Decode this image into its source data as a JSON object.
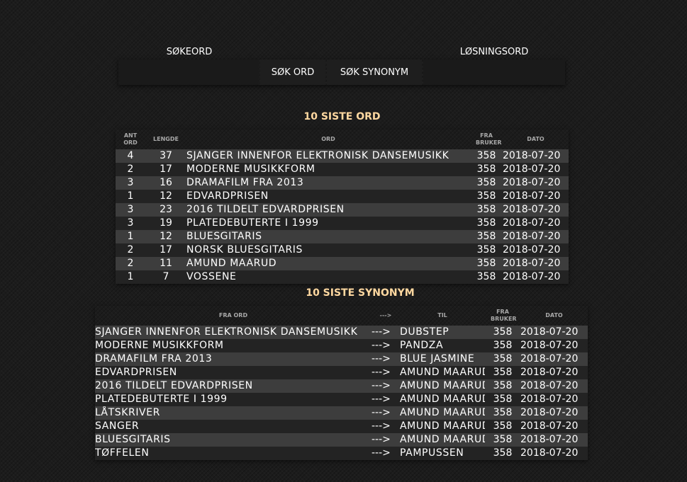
{
  "search": {
    "keyword_label": "SØKEORD",
    "solution_label": "LØSNINGSORD",
    "keyword_value": "",
    "solution_value": "",
    "search_word_button": "SØK ORD",
    "search_synonym_button": "SØK SYNONYM"
  },
  "words": {
    "title": "10 SISTE ORD",
    "headers": {
      "count": "ANT ORD",
      "length": "LENGDE",
      "word": "ORD",
      "user": "FRA BRUKER",
      "date": "DATO"
    },
    "rows": [
      {
        "count": "4",
        "length": "37",
        "word": "SJANGER INNENFOR ELEKTRONISK DANSEMUSIKK",
        "user": "358",
        "date": "2018-07-20"
      },
      {
        "count": "2",
        "length": "17",
        "word": "MODERNE MUSIKKFORM",
        "user": "358",
        "date": "2018-07-20"
      },
      {
        "count": "3",
        "length": "16",
        "word": "DRAMAFILM FRA 2013",
        "user": "358",
        "date": "2018-07-20"
      },
      {
        "count": "1",
        "length": "12",
        "word": "EDVARDPRISEN",
        "user": "358",
        "date": "2018-07-20"
      },
      {
        "count": "3",
        "length": "23",
        "word": "2016 TILDELT EDVARDPRISEN",
        "user": "358",
        "date": "2018-07-20"
      },
      {
        "count": "3",
        "length": "19",
        "word": "PLATEDEBUTERTE I 1999",
        "user": "358",
        "date": "2018-07-20"
      },
      {
        "count": "1",
        "length": "12",
        "word": "BLUESGITARIS",
        "user": "358",
        "date": "2018-07-20"
      },
      {
        "count": "2",
        "length": "17",
        "word": "NORSK BLUESGITARIS",
        "user": "358",
        "date": "2018-07-20"
      },
      {
        "count": "2",
        "length": "11",
        "word": "AMUND MAARUD",
        "user": "358",
        "date": "2018-07-20"
      },
      {
        "count": "1",
        "length": "7",
        "word": "VOSSENE",
        "user": "358",
        "date": "2018-07-20"
      }
    ]
  },
  "synonyms": {
    "title": "10 SISTE SYNONYM",
    "headers": {
      "from": "FRA ORD",
      "arrow": "--->",
      "to": "TIL",
      "user": "FRA BRUKER",
      "date": "DATO"
    },
    "rows": [
      {
        "from": "SJANGER INNENFOR ELEKTRONISK DANSEMUSIKK",
        "arrow": "--->",
        "to": "DUBSTEP",
        "user": "358",
        "date": "2018-07-20"
      },
      {
        "from": "MODERNE MUSIKKFORM",
        "arrow": "--->",
        "to": "PANDZA",
        "user": "358",
        "date": "2018-07-20"
      },
      {
        "from": "DRAMAFILM FRA 2013",
        "arrow": "--->",
        "to": "BLUE JASMINE",
        "user": "358",
        "date": "2018-07-20"
      },
      {
        "from": "EDVARDPRISEN",
        "arrow": "--->",
        "to": "AMUND MAARUD",
        "user": "358",
        "date": "2018-07-20"
      },
      {
        "from": "2016 TILDELT EDVARDPRISEN",
        "arrow": "--->",
        "to": "AMUND MAARUD",
        "user": "358",
        "date": "2018-07-20"
      },
      {
        "from": "PLATEDEBUTERTE I 1999",
        "arrow": "--->",
        "to": "AMUND MAARUD",
        "user": "358",
        "date": "2018-07-20"
      },
      {
        "from": "LÅTSKRIVER",
        "arrow": "--->",
        "to": "AMUND MAARUD",
        "user": "358",
        "date": "2018-07-20"
      },
      {
        "from": "SANGER",
        "arrow": "--->",
        "to": "AMUND MAARUD",
        "user": "358",
        "date": "2018-07-20"
      },
      {
        "from": "BLUESGITARIS",
        "arrow": "--->",
        "to": "AMUND MAARUD",
        "user": "358",
        "date": "2018-07-20"
      },
      {
        "from": "TØFFELEN",
        "arrow": "--->",
        "to": "PAMPUSSEN",
        "user": "358",
        "date": "2018-07-20"
      }
    ]
  }
}
